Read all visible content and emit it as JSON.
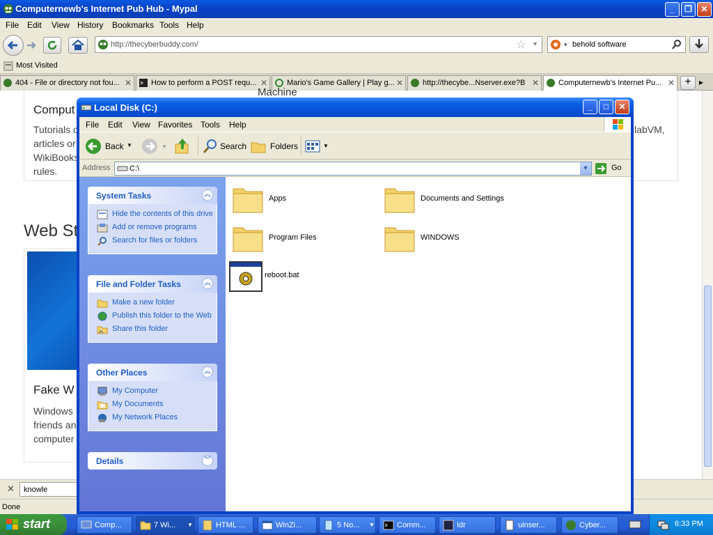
{
  "firefox": {
    "title": "Computernewb's Internet Pub Hub - Mypal",
    "menu": [
      "File",
      "Edit",
      "View",
      "History",
      "Bookmarks",
      "Tools",
      "Help"
    ],
    "url": "http://thecyberbuddy.com/",
    "search_value": "behold software",
    "bookmarks_label": "Most Visited",
    "tabs": [
      {
        "label": "404 - File or directory not fou..."
      },
      {
        "label": "How to perform a POST requ..."
      },
      {
        "label": "Mario's Game Gallery | Play g..."
      },
      {
        "label": "http://thecybe...Nserver.exe?B"
      },
      {
        "label": "Computernewb's Internet Pu..."
      }
    ],
    "page": {
      "heading_top": "Machine",
      "heading_1": "Comput",
      "text_1_lines": [
        "Tutorials o",
        "articles or",
        "WikiBooks",
        "rules."
      ],
      "right_text": "llabVM,",
      "section_heading": "Web St",
      "card_heading": "Fake W",
      "card_lines": [
        "Windows",
        "friends an",
        "computer"
      ]
    },
    "find_value": "knowle",
    "status": "Done"
  },
  "explorer": {
    "title": "Local Disk (C:)",
    "menu": [
      "File",
      "Edit",
      "View",
      "Favorites",
      "Tools",
      "Help"
    ],
    "toolbar": {
      "back": "Back",
      "search": "Search",
      "folders": "Folders"
    },
    "address_label": "Address",
    "address_value": "C:\\",
    "go_label": "Go",
    "panels": {
      "system_tasks": {
        "title": "System Tasks",
        "items": [
          "Hide the contents of this drive",
          "Add or remove programs",
          "Search for files or folders"
        ]
      },
      "file_folder_tasks": {
        "title": "File and Folder Tasks",
        "items": [
          "Make a new folder",
          "Publish this folder to the Web",
          "Share this folder"
        ]
      },
      "other_places": {
        "title": "Other Places",
        "items": [
          "My Computer",
          "My Documents",
          "My Network Places"
        ]
      },
      "details": {
        "title": "Details"
      }
    },
    "files": [
      {
        "name": "Apps",
        "icon": "folder-icon"
      },
      {
        "name": "Documents and Settings",
        "icon": "folder-icon"
      },
      {
        "name": "Program Files",
        "icon": "folder-icon"
      },
      {
        "name": "WINDOWS",
        "icon": "folder-icon"
      },
      {
        "name": "reboot.bat",
        "icon": "batch-file-icon"
      }
    ]
  },
  "taskbar": {
    "start_label": "start",
    "items": [
      {
        "label": "Comp..."
      },
      {
        "label": "7 Wi..."
      },
      {
        "label": "HTML ..."
      },
      {
        "label": "WinZi..."
      },
      {
        "label": "5 No..."
      },
      {
        "label": "Comm..."
      },
      {
        "label": "Idr"
      },
      {
        "label": "uinser..."
      },
      {
        "label": "Cyber..."
      }
    ],
    "clock": "6:33 PM"
  },
  "colors": {
    "xp_blue": "#0842c6",
    "task_link": "#215dc6",
    "start_green": "#3c8f3c"
  }
}
